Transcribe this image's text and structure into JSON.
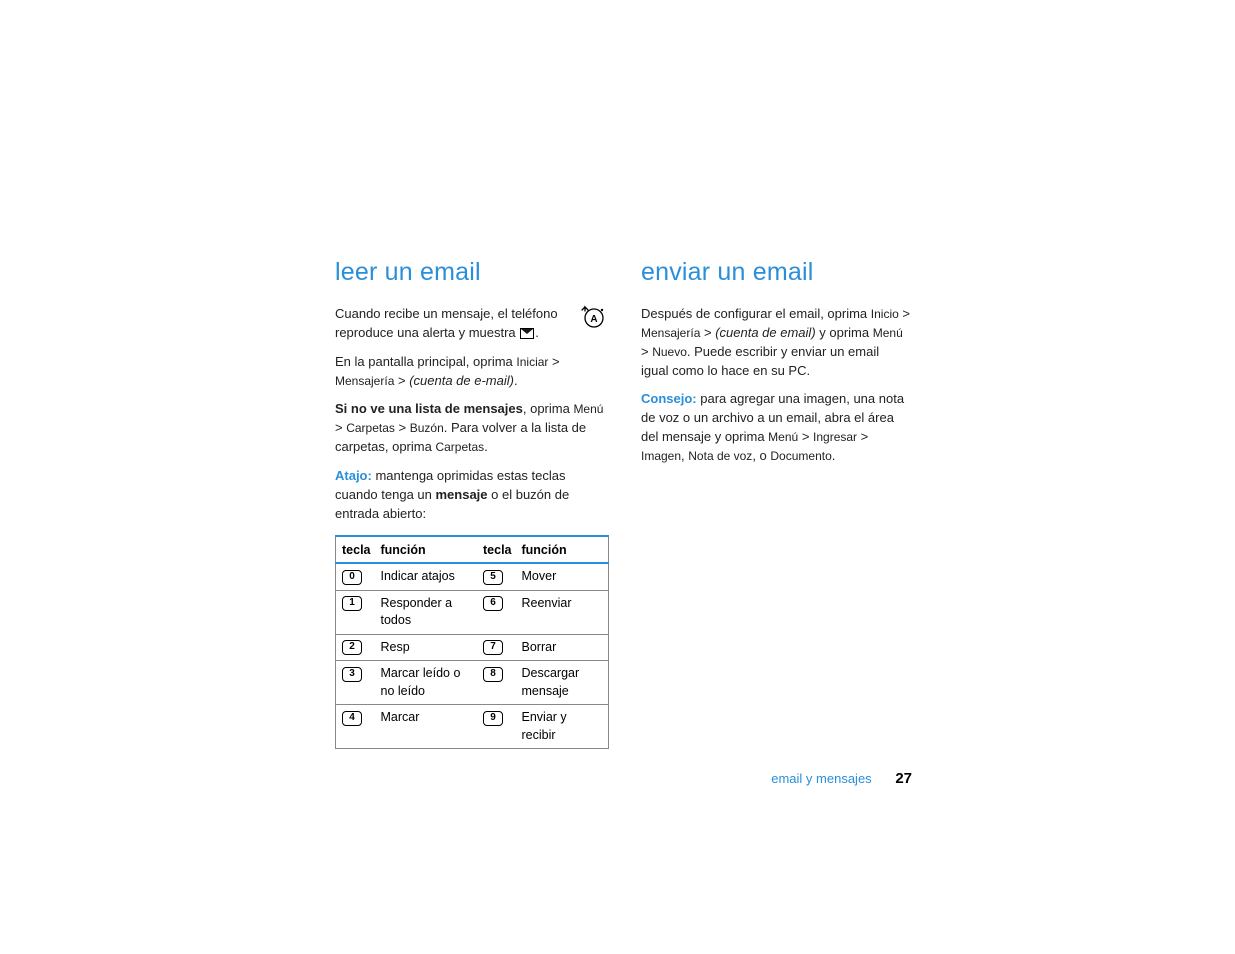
{
  "left": {
    "heading": "leer un email",
    "p1_a": "Cuando recibe un mensaje, el teléfono reproduce una alerta y muestra ",
    "p1_b": ".",
    "p2_a": "En la pantalla principal, oprima ",
    "p2_menu1": "Iniciar",
    "p2_gt": " > ",
    "p2_menu2": "Mensajería",
    "p2_c": " > ",
    "p2_acct": "(cuenta de e-mail)",
    "p2_end": ".",
    "p3_bold": "Si no ve una lista de mensajes",
    "p3_a": ", oprima ",
    "p3_m1": "Menú",
    "p3_gt1": " > ",
    "p3_m2": "Carpetas",
    "p3_gt2": " > ",
    "p3_m3": "Buzón",
    "p3_b": ". Para volver a la lista de carpetas, oprima ",
    "p3_m4": "Carpetas",
    "p3_end": ".",
    "p4_label": "Atajo:",
    "p4_a": " mantenga oprimidas estas teclas cuando tenga un ",
    "p4_bold": "mensaje",
    "p4_b": " o el buzón de entrada abierto:",
    "table": {
      "h1": "tecla",
      "h2": "función",
      "h3": "tecla",
      "h4": "función",
      "rows": [
        {
          "k1": "0",
          "f1": "Indicar atajos",
          "k2": "5",
          "f2": "Mover"
        },
        {
          "k1": "1",
          "f1": "Responder a todos",
          "k2": "6",
          "f2": "Reenviar"
        },
        {
          "k1": "2",
          "f1": "Resp",
          "k2": "7",
          "f2": "Borrar"
        },
        {
          "k1": "3",
          "f1": "Marcar leído o no leído",
          "k2": "8",
          "f2": "Descargar mensaje"
        },
        {
          "k1": "4",
          "f1": "Marcar",
          "k2": "9",
          "f2": "Enviar y recibir"
        }
      ]
    }
  },
  "right": {
    "heading": "enviar un email",
    "p1_a": "Después de configurar el email, oprima ",
    "p1_m1": "Inicio",
    "p1_gt1": " > ",
    "p1_m2": "Mensajería",
    "p1_b": " > ",
    "p1_acct": "(cuenta de email)",
    "p1_c": " y oprima ",
    "p1_m3": "Menú",
    "p1_gt2": " > ",
    "p1_m4": "Nuevo",
    "p1_d": ". Puede escribir y enviar un email igual como lo hace en su PC.",
    "p2_label": "Consejo:",
    "p2_a": " para agregar una imagen, una nota de voz o un archivo a un email, abra el área del mensaje y oprima ",
    "p2_m1": "Menú",
    "p2_gt1": " > ",
    "p2_m2": "Ingresar",
    "p2_gt2": " > ",
    "p2_m3": "Imagen",
    "p2_comma1": ", ",
    "p2_m4": "Nota de voz",
    "p2_comma2": ", o ",
    "p2_m5": "Documento",
    "p2_end": "."
  },
  "footer": {
    "label": "email y mensajes",
    "page": "27"
  }
}
